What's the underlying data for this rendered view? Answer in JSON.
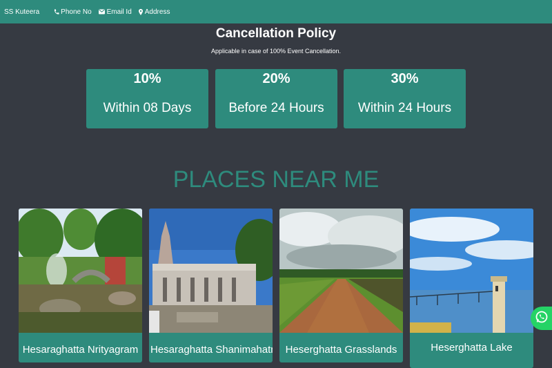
{
  "topbar": {
    "brand": "SS Kuteera",
    "phone_label": "Phone No",
    "email_label": "Email Id",
    "address_label": "Address"
  },
  "policy": {
    "title": "Cancellation Policy",
    "subtitle": "Applicable in case of 100% Event Cancellation.",
    "cards": [
      {
        "percent": "10%",
        "label": "Within 08 Days"
      },
      {
        "percent": "20%",
        "label": "Before 24 Hours"
      },
      {
        "percent": "30%",
        "label": "Within 24 Hours"
      }
    ]
  },
  "places": {
    "heading": "PLACES NEAR ME",
    "items": [
      {
        "name": "Hesaraghatta Nrityagram"
      },
      {
        "name": "Hesaraghatta Shanimahatma"
      },
      {
        "name": "Heserghatta Grasslands"
      },
      {
        "name": "Heserghatta Lake"
      }
    ]
  },
  "colors": {
    "accent": "#2e8b7d",
    "background": "#363a42",
    "whatsapp": "#25d366"
  },
  "icons": [
    "phone-icon",
    "envelope-icon",
    "map-marker-icon",
    "whatsapp-icon"
  ]
}
